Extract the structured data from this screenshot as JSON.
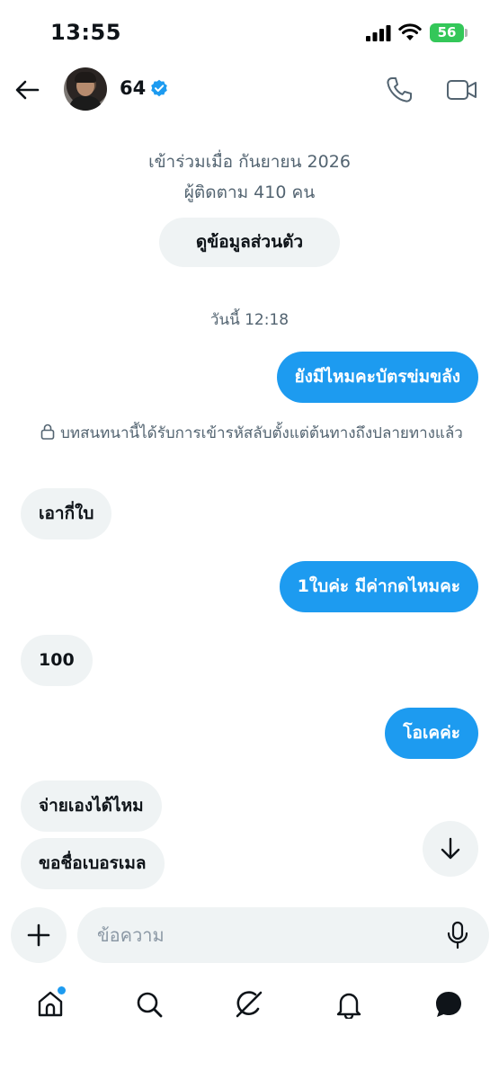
{
  "status_bar": {
    "time": "13:55",
    "battery_level": "56",
    "battery_color": "#34c759"
  },
  "header": {
    "back_icon": "arrow-left-icon",
    "username": "64",
    "verified_icon": "verified-badge-icon",
    "call_icon": "phone-icon",
    "video_icon": "video-camera-icon"
  },
  "profile_info": {
    "joined": "เข้าร่วมเมื่อ กันยายน 2026",
    "followers": "ผู้ติดตาม 410 คน",
    "view_profile_label": "ดูข้อมูลส่วนตัว"
  },
  "conversation": {
    "date_label": "วันนี้ 12:18",
    "encryption_notice": "บทสนทนานี้ได้รับการเข้ารหัสลับตั้งแต่ต้นทางถึงปลายทางแล้ว",
    "messages": [
      {
        "direction": "sent",
        "text": "ยังมีไหมคะบัตรข่มขลัง"
      },
      {
        "direction": "received",
        "text": "เอากี่ใบ"
      },
      {
        "direction": "sent",
        "text": "1ใบค่ะ มีค่ากดไหมคะ"
      },
      {
        "direction": "received",
        "text": "100"
      },
      {
        "direction": "sent",
        "text": "โอเคค่ะ"
      },
      {
        "direction": "received",
        "text": "จ่ายเองได้ไหม"
      },
      {
        "direction": "received",
        "text": "ขอชื่อเบอรเมล"
      }
    ]
  },
  "composer": {
    "placeholder": "ข้อความ",
    "add_icon": "plus-icon",
    "mic_icon": "microphone-icon",
    "scroll_icon": "arrow-down-icon"
  },
  "bottom_nav": {
    "items": [
      "home-icon",
      "search-icon",
      "grok-icon",
      "bell-icon",
      "messages-icon"
    ],
    "active": "messages-icon"
  },
  "colors": {
    "accent": "#1d9bf0",
    "received_bubble": "#eff3f4",
    "secondary_text": "#536471"
  }
}
